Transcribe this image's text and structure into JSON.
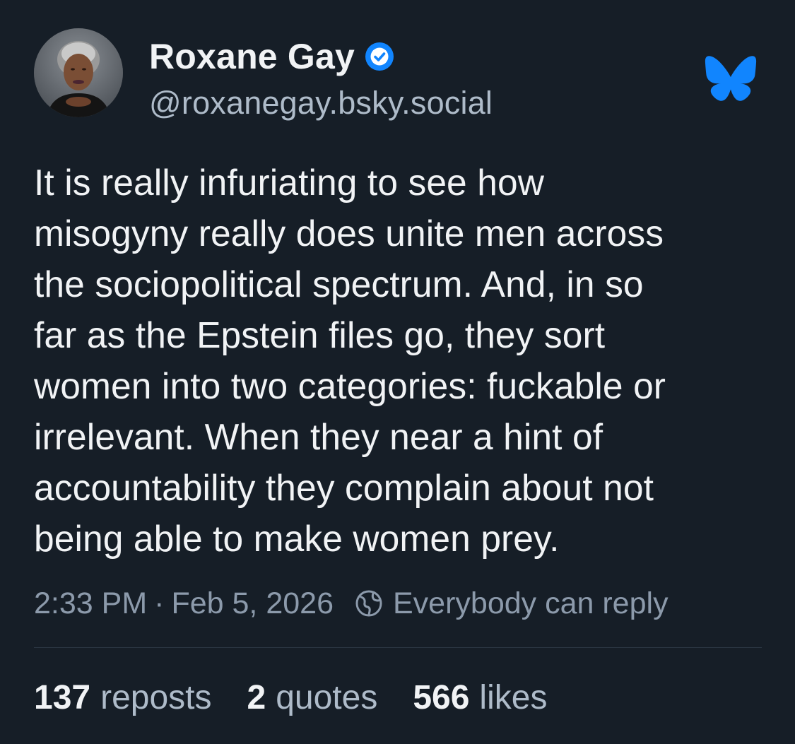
{
  "author": {
    "name": "Roxane Gay",
    "handle": "@roxanegay.bsky.social",
    "verified": true
  },
  "icons": {
    "avatar": "profile-photo",
    "verified": "verified-check-icon",
    "logo": "bluesky-butterfly-icon",
    "reply_setting": "globe-icon"
  },
  "post": {
    "text": "It is really infuriating to see how\nmisogyny really does unite men across\nthe sociopolitical spectrum. And, in so\nfar as the Epstein files go, they sort\nwomen into two categories: fuckable or\nirrelevant. When they near a hint of\naccountability they complain about not\nbeing able to make women prey.",
    "time": "2:33 PM",
    "separator": "·",
    "date": "Feb 5, 2026",
    "reply_setting": "Everybody can reply"
  },
  "stats": {
    "reposts_count": "137",
    "reposts_label": "reposts",
    "quotes_count": "2",
    "quotes_label": "quotes",
    "likes_count": "566",
    "likes_label": "likes"
  },
  "colors": {
    "background": "#161e27",
    "primary_text": "#f1f3f5",
    "secondary_text": "#aebbc9",
    "meta_text": "#8c9aab",
    "brand_blue": "#1185fe"
  }
}
